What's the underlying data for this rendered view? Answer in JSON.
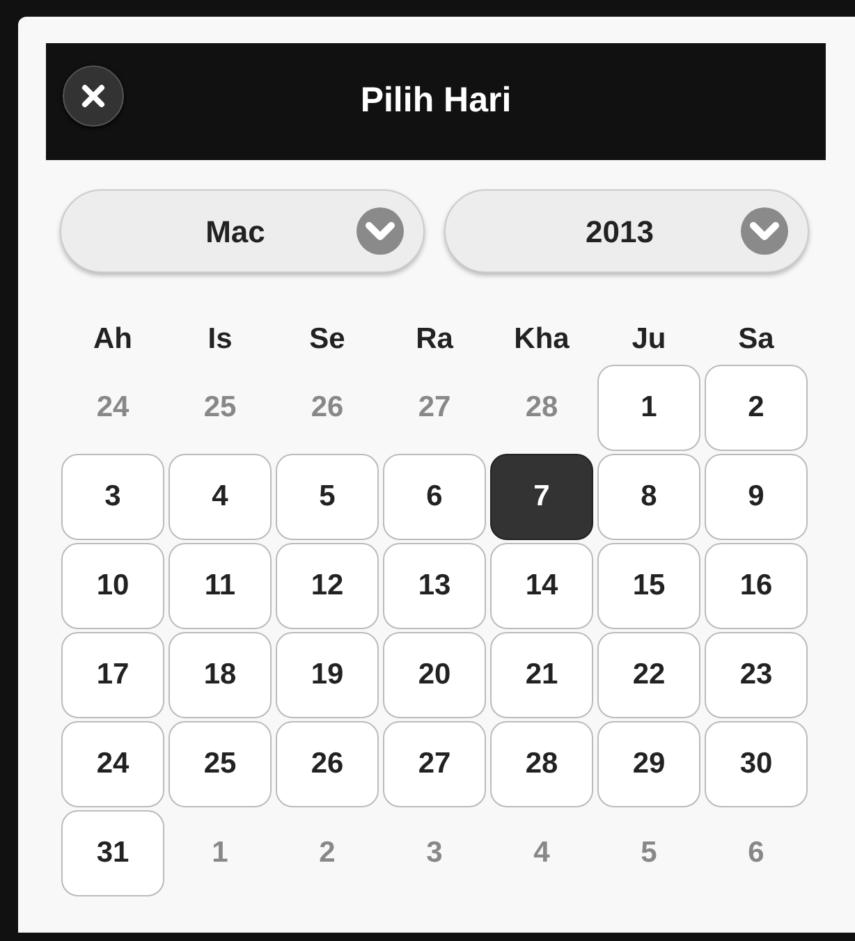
{
  "header": {
    "title": "Pilih Hari"
  },
  "selects": [
    {
      "value": "Mac"
    },
    {
      "value": "2013"
    }
  ],
  "weekdays": [
    "Ah",
    "Is",
    "Se",
    "Ra",
    "Kha",
    "Ju",
    "Sa"
  ],
  "weeks": [
    [
      {
        "label": "24",
        "in_month": false,
        "selected": false
      },
      {
        "label": "25",
        "in_month": false,
        "selected": false
      },
      {
        "label": "26",
        "in_month": false,
        "selected": false
      },
      {
        "label": "27",
        "in_month": false,
        "selected": false
      },
      {
        "label": "28",
        "in_month": false,
        "selected": false
      },
      {
        "label": "1",
        "in_month": true,
        "selected": false
      },
      {
        "label": "2",
        "in_month": true,
        "selected": false
      }
    ],
    [
      {
        "label": "3",
        "in_month": true,
        "selected": false
      },
      {
        "label": "4",
        "in_month": true,
        "selected": false
      },
      {
        "label": "5",
        "in_month": true,
        "selected": false
      },
      {
        "label": "6",
        "in_month": true,
        "selected": false
      },
      {
        "label": "7",
        "in_month": true,
        "selected": true
      },
      {
        "label": "8",
        "in_month": true,
        "selected": false
      },
      {
        "label": "9",
        "in_month": true,
        "selected": false
      }
    ],
    [
      {
        "label": "10",
        "in_month": true,
        "selected": false
      },
      {
        "label": "11",
        "in_month": true,
        "selected": false
      },
      {
        "label": "12",
        "in_month": true,
        "selected": false
      },
      {
        "label": "13",
        "in_month": true,
        "selected": false
      },
      {
        "label": "14",
        "in_month": true,
        "selected": false
      },
      {
        "label": "15",
        "in_month": true,
        "selected": false
      },
      {
        "label": "16",
        "in_month": true,
        "selected": false
      }
    ],
    [
      {
        "label": "17",
        "in_month": true,
        "selected": false
      },
      {
        "label": "18",
        "in_month": true,
        "selected": false
      },
      {
        "label": "19",
        "in_month": true,
        "selected": false
      },
      {
        "label": "20",
        "in_month": true,
        "selected": false
      },
      {
        "label": "21",
        "in_month": true,
        "selected": false
      },
      {
        "label": "22",
        "in_month": true,
        "selected": false
      },
      {
        "label": "23",
        "in_month": true,
        "selected": false
      }
    ],
    [
      {
        "label": "24",
        "in_month": true,
        "selected": false
      },
      {
        "label": "25",
        "in_month": true,
        "selected": false
      },
      {
        "label": "26",
        "in_month": true,
        "selected": false
      },
      {
        "label": "27",
        "in_month": true,
        "selected": false
      },
      {
        "label": "28",
        "in_month": true,
        "selected": false
      },
      {
        "label": "29",
        "in_month": true,
        "selected": false
      },
      {
        "label": "30",
        "in_month": true,
        "selected": false
      }
    ],
    [
      {
        "label": "31",
        "in_month": true,
        "selected": false
      },
      {
        "label": "1",
        "in_month": false,
        "selected": false
      },
      {
        "label": "2",
        "in_month": false,
        "selected": false
      },
      {
        "label": "3",
        "in_month": false,
        "selected": false
      },
      {
        "label": "4",
        "in_month": false,
        "selected": false
      },
      {
        "label": "5",
        "in_month": false,
        "selected": false
      },
      {
        "label": "6",
        "in_month": false,
        "selected": false
      }
    ]
  ]
}
